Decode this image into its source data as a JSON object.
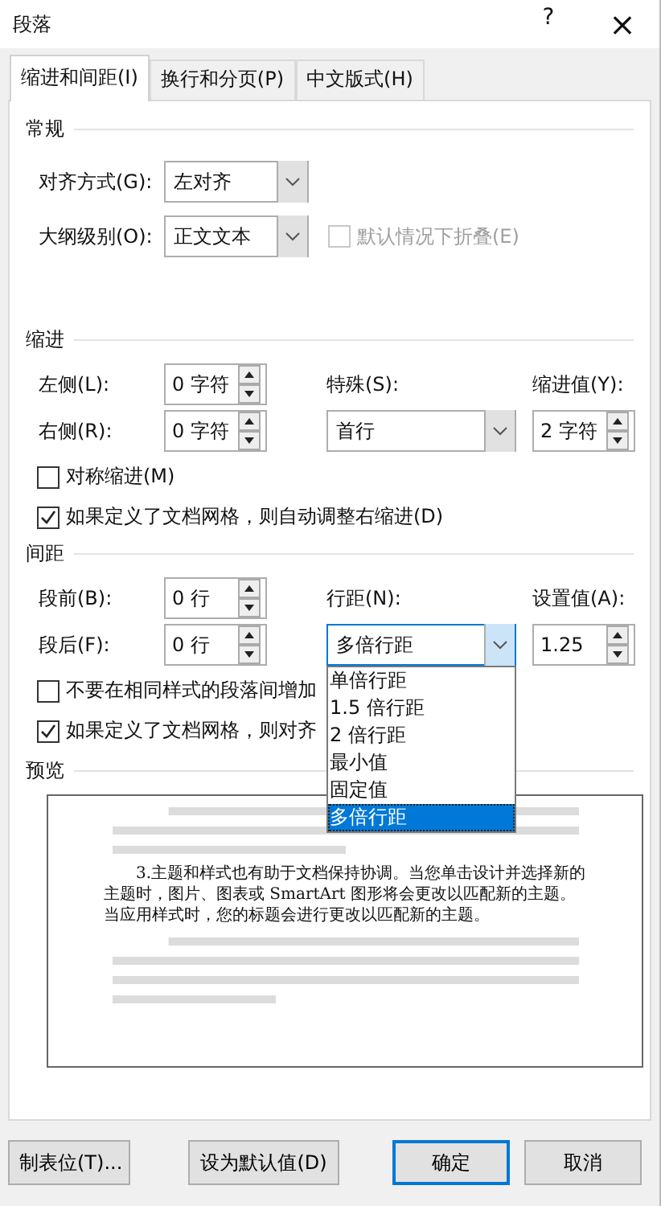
{
  "window": {
    "title": "段落",
    "help": "?",
    "close": "×"
  },
  "tabs": [
    {
      "label": "缩进和间距(I)",
      "selected": true
    },
    {
      "label": "换行和分页(P)",
      "selected": false
    },
    {
      "label": "中文版式(H)",
      "selected": false
    }
  ],
  "general": {
    "title": "常规",
    "alignment": {
      "label": "对齐方式(G):",
      "value": "左对齐"
    },
    "outline_level": {
      "label": "大纲级别(O):",
      "value": "正文文本"
    },
    "collapse": {
      "label": "默认情况下折叠(E)",
      "checked": false,
      "disabled": true
    }
  },
  "indent": {
    "title": "缩进",
    "left": {
      "label": "左侧(L):",
      "value": "0 字符"
    },
    "right": {
      "label": "右侧(R):",
      "value": "0 字符"
    },
    "special": {
      "label": "特殊(S):",
      "value": "首行"
    },
    "by": {
      "label": "缩进值(Y):",
      "value": "2 字符"
    },
    "checkboxes": [
      {
        "label": "对称缩进(M)",
        "checked": false
      },
      {
        "label": "如果定义了文档网格，则自动调整右缩进(D)",
        "checked": true
      }
    ]
  },
  "spacing": {
    "title": "间距",
    "before": {
      "label": "段前(B):",
      "value": "0 行"
    },
    "after": {
      "label": "段后(F):",
      "value": "0 行"
    },
    "line_spacing": {
      "label": "行距(N):",
      "value": "多倍行距",
      "expanded": true,
      "options": [
        {
          "label": "单倍行距",
          "selected": false
        },
        {
          "label": "1.5 倍行距",
          "selected": false
        },
        {
          "label": "2 倍行距",
          "selected": false
        },
        {
          "label": "最小值",
          "selected": false
        },
        {
          "label": "固定值",
          "selected": false
        },
        {
          "label": "多倍行距",
          "selected": true
        }
      ]
    },
    "at": {
      "label": "设置值(A):",
      "value": "1.25"
    },
    "checkboxes": [
      {
        "label": "不要在相同样式的段落间增加",
        "checked": false
      },
      {
        "label": "如果定义了文档网格，则对齐",
        "checked": true
      }
    ]
  },
  "preview": {
    "title": "预览",
    "paragraph": "3.主题和样式也有助于文档保持协调。当您单击设计并选择新的主题时，图片、图表或 SmartArt 图形将会更改以匹配新的主题。当应用样式时，您的标题会进行更改以匹配新的主题。"
  },
  "buttons": [
    {
      "label": "制表位(T)...",
      "default": false
    },
    {
      "label": "设为默认值(D)",
      "default": false
    },
    {
      "label": "确定",
      "default": true
    },
    {
      "label": "取消",
      "default": false
    }
  ]
}
